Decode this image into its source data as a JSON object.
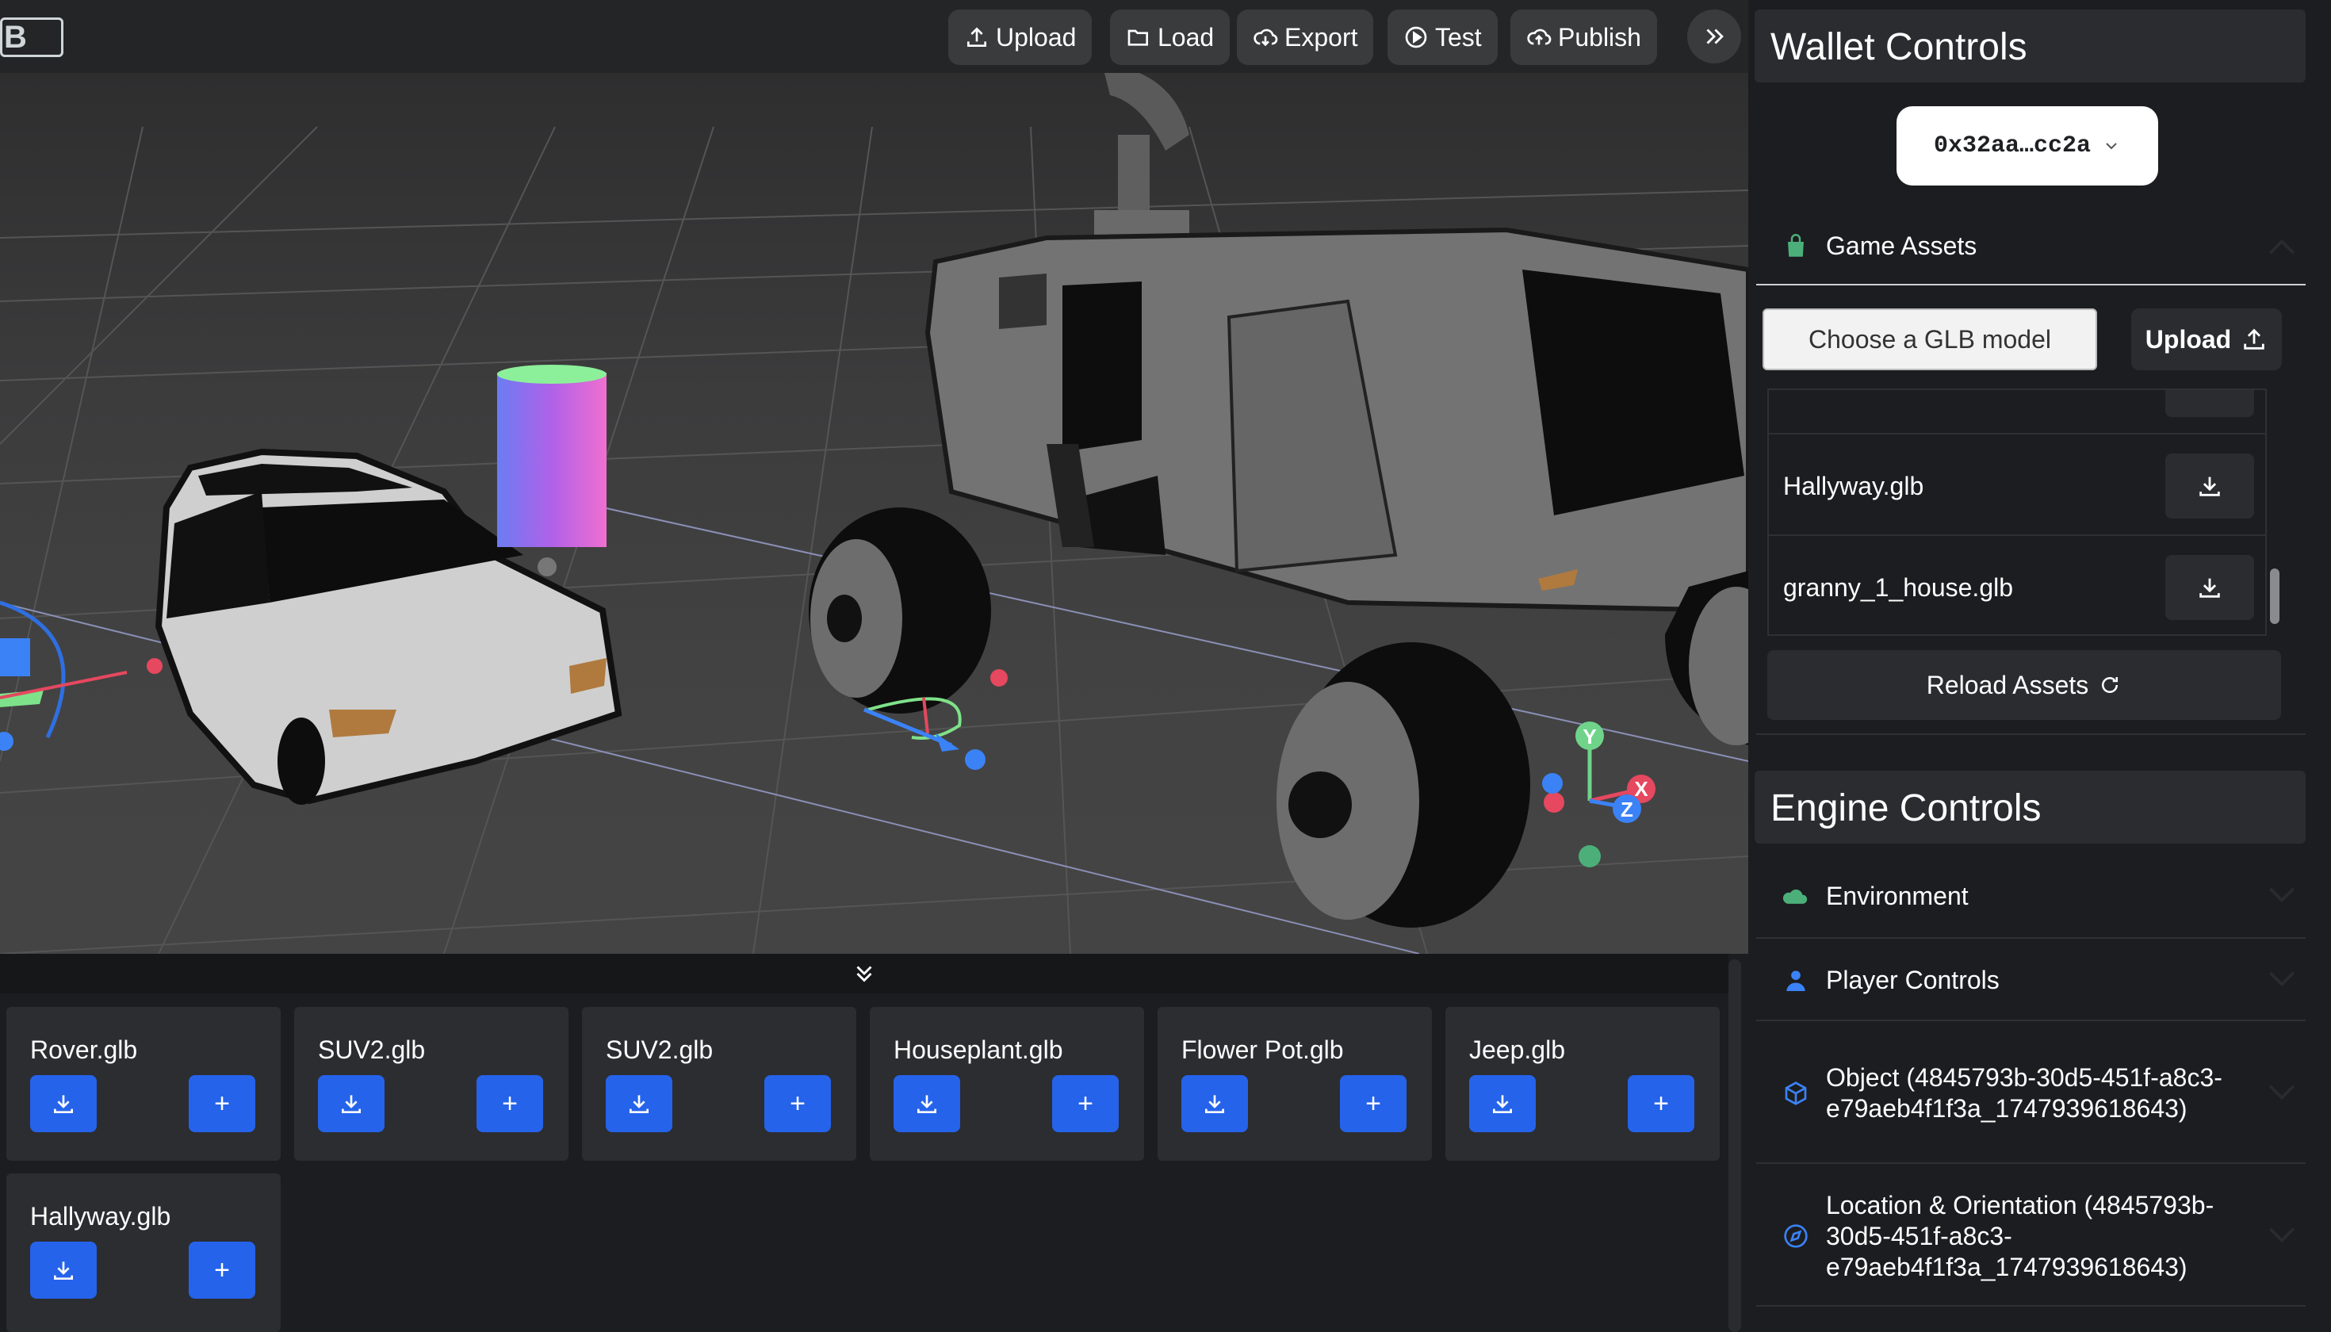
{
  "toolbar": {
    "upload": "Upload",
    "load": "Load",
    "export": "Export",
    "test": "Test",
    "publish": "Publish"
  },
  "gizmo_axes": {
    "y": "Y",
    "x": "X",
    "z": "Z"
  },
  "asset_tray": {
    "cards": [
      {
        "name": "Rover.glb"
      },
      {
        "name": "SUV2.glb"
      },
      {
        "name": "SUV2.glb"
      },
      {
        "name": "Houseplant.glb"
      },
      {
        "name": "Flower Pot.glb"
      },
      {
        "name": "Jeep.glb"
      },
      {
        "name": "Hallyway.glb"
      }
    ],
    "add_symbol": "+"
  },
  "wallet": {
    "title": "Wallet Controls",
    "address": "0x32aa…cc2a",
    "game_assets_label": "Game Assets",
    "file_input_label": "Choose a GLB model",
    "upload_label": "Upload",
    "assets": [
      {
        "name": "Hallyway.glb"
      },
      {
        "name": "granny_1_house.glb"
      }
    ],
    "reload_label": "Reload Assets"
  },
  "engine": {
    "title": "Engine Controls",
    "sections": {
      "environment": "Environment",
      "player_controls": "Player Controls",
      "object": "Object (4845793b-30d5-451f-a8c3-e79aeb4f1f3a_1747939618643)",
      "location": "Location & Orientation (4845793b-30d5-451f-a8c3-e79aeb4f1f3a_1747939618643)"
    }
  },
  "colors": {
    "accent_blue": "#2563eb",
    "environment_icon": "#4caf7a",
    "player_icon": "#3b82f6",
    "game_assets_icon": "#4caf7a"
  }
}
